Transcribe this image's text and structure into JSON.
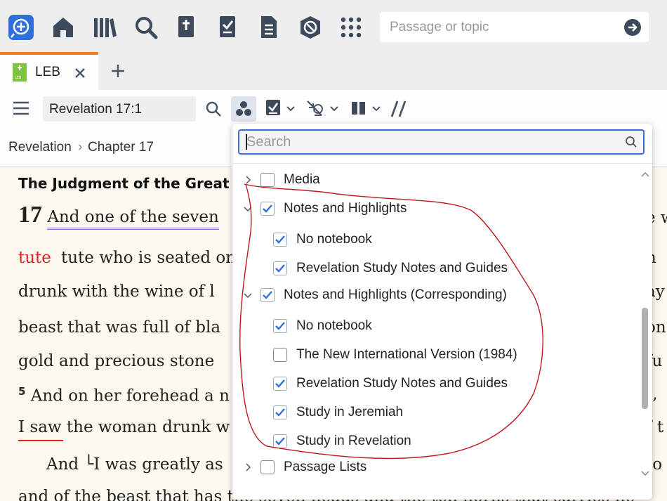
{
  "top_search": {
    "placeholder": "Passage or topic"
  },
  "tabs": [
    {
      "label": "LEB",
      "icon_text": "LEB"
    }
  ],
  "toolbar": {
    "reference": "Revelation 17:1"
  },
  "breadcrumb": {
    "book": "Revelation",
    "separator": "›",
    "chapter": "Chapter 17"
  },
  "content": {
    "heading": "The Judgment of the Great P",
    "chapter_number": "17",
    "lines": [
      "And one of the seven",
      "tute who is seated on m",
      "drunk with the wine of l",
      "beast that was full of bla",
      "gold and precious stone",
      "And on her forehead a n",
      "I saw the woman drunk w",
      "And └I was greatly as",
      "and of the beast that has the seven heads and the ten horns that carries he"
    ],
    "verse_5_number": "5",
    "red_word": "tute",
    "right_edge": [
      "e w",
      "n",
      "ay",
      "on",
      "fu",
      "t,",
      "f t",
      "to"
    ]
  },
  "dropdown": {
    "search_placeholder": "Search",
    "items": [
      {
        "label": "Media",
        "level": 0,
        "expander": "collapsed",
        "checked": false
      },
      {
        "label": "Notes and Highlights",
        "level": 0,
        "expander": "expanded",
        "checked": true
      },
      {
        "label": "No notebook",
        "level": 1,
        "checked": true
      },
      {
        "label": "Revelation Study Notes and Guides",
        "level": 1,
        "checked": true
      },
      {
        "label": "Notes and Highlights (Corresponding)",
        "level": 0,
        "expander": "expanded",
        "checked": true
      },
      {
        "label": "No notebook",
        "level": 1,
        "checked": true
      },
      {
        "label": "The New International Version (1984)",
        "level": 1,
        "checked": false
      },
      {
        "label": "Revelation Study Notes and Guides",
        "level": 1,
        "checked": true
      },
      {
        "label": "Study in Jeremiah",
        "level": 1,
        "checked": true
      },
      {
        "label": "Study in Revelation",
        "level": 1,
        "checked": true
      },
      {
        "label": "Passage Lists",
        "level": 0,
        "expander": "collapsed",
        "checked": false
      }
    ]
  },
  "colors": {
    "accent": "#2f6fdc",
    "tab_indicator": "#f47b20",
    "annotation": "#c0181e",
    "red_text": "#e02020",
    "link_underline": "#8b6fd0"
  }
}
